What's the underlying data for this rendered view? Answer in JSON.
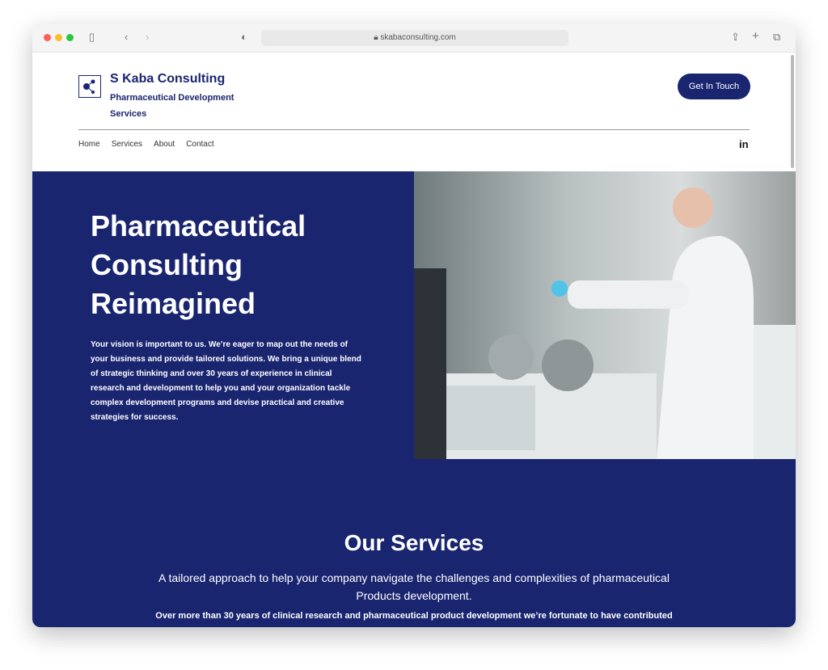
{
  "browser": {
    "url": "skabaconsulting.com"
  },
  "header": {
    "brand": "S Kaba Consulting",
    "tagline": "Pharmaceutical Development Services",
    "cta": "Get In Touch",
    "nav": [
      "Home",
      "Services",
      "About",
      "Contact"
    ],
    "social": "in"
  },
  "hero": {
    "title": "Pharmaceutical Consulting Reimagined",
    "body": "Your vision is important to us. We’re eager to map out the needs of your business and provide tailored solutions. We bring a unique blend of strategic thinking and over 30 years of experience in clinical research and development to help you and your organization tackle complex development programs and devise practical and creative strategies for success."
  },
  "services": {
    "title": "Our Services",
    "subtitle": "A tailored approach to help your company navigate the challenges and complexities of pharmaceutical Products development.",
    "body": "Over more than 30 years of clinical research and pharmaceutical product development we’re fortunate to have contributed"
  },
  "colors": {
    "brand": "#1a2570"
  }
}
